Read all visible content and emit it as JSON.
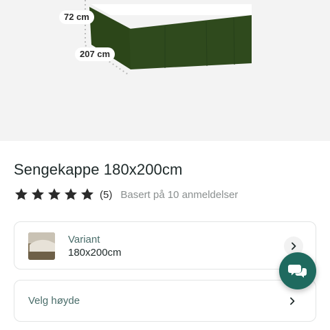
{
  "hero": {
    "height_label": "72 cm",
    "length_label": "207 cm",
    "product_color": "#2f4a1d"
  },
  "product": {
    "title": "Sengekappe 180x200cm",
    "rating": {
      "stars": 5,
      "max_stars": 5,
      "count": "(5)",
      "based_on": "Basert på 10 anmeldelser"
    }
  },
  "variant": {
    "label": "Variant",
    "value": "180x200cm",
    "icon": "chevron-right-icon"
  },
  "height_select": {
    "label": "Velg høyde",
    "icon": "chevron-right-icon"
  },
  "chat": {
    "icon": "chat-bubbles-icon",
    "color": "#1f6a5f"
  },
  "colors": {
    "accent": "#1f6a5f",
    "label_teal": "#4a6d6a",
    "star": "#2b2b2b"
  }
}
